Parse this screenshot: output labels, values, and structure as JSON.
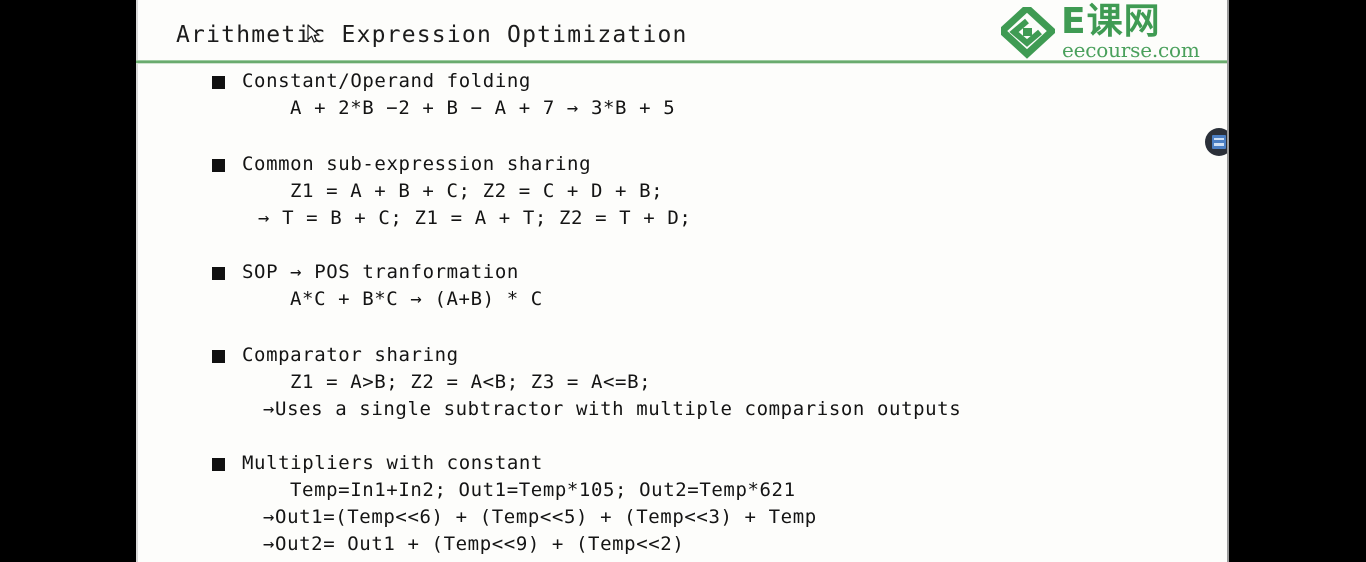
{
  "slide": {
    "title": "Arithmetic Expression Optimization",
    "logo": {
      "mark_name": "eecourse-spiral-logo",
      "cn_text": "E课网",
      "domain_text": "eecourse.com",
      "color": "#3f9b53"
    },
    "accent_color": "#6aab6e",
    "background_color": "#fdfdfb",
    "bullets": [
      {
        "heading": "Constant/Operand folding",
        "lines": [
          {
            "indent": "ind-1",
            "text": "A + 2*B −2 + B  −  A + 7 → 3*B + 5"
          }
        ]
      },
      {
        "heading": "Common sub-expression sharing",
        "lines": [
          {
            "indent": "ind-1",
            "text": "Z1 = A + B + C; Z2 = C + D + B;"
          },
          {
            "indent": "ind-arrow",
            "text": "→ T = B + C; Z1 = A + T; Z2 = T + D;"
          }
        ]
      },
      {
        "heading": "SOP → POS tranformation",
        "lines": [
          {
            "indent": "ind-1",
            "text": "A*C + B*C → (A+B) * C"
          }
        ]
      },
      {
        "heading": "Comparator sharing",
        "lines": [
          {
            "indent": "ind-1",
            "text": "Z1 = A>B; Z2 = A<B; Z3 = A<=B;"
          },
          {
            "indent": "ind-arrow-tight",
            "text": "→Uses a single subtractor with multiple comparison outputs"
          }
        ]
      },
      {
        "heading": "Multipliers with constant",
        "lines": [
          {
            "indent": "ind-1",
            "text": "Temp=In1+In2; Out1=Temp*105; Out2=Temp*621"
          },
          {
            "indent": "ind-arrow-tight",
            "text": "→Out1=(Temp<<6) + (Temp<<5) + (Temp<<3) + Temp"
          },
          {
            "indent": "ind-arrow-tight",
            "text": "→Out2= Out1 + (Temp<<9) + (Temp<<2)"
          }
        ]
      }
    ],
    "note_badge": {
      "icon": "note-document-icon"
    },
    "cursor": {
      "icon": "mouse-pointer-icon"
    }
  }
}
